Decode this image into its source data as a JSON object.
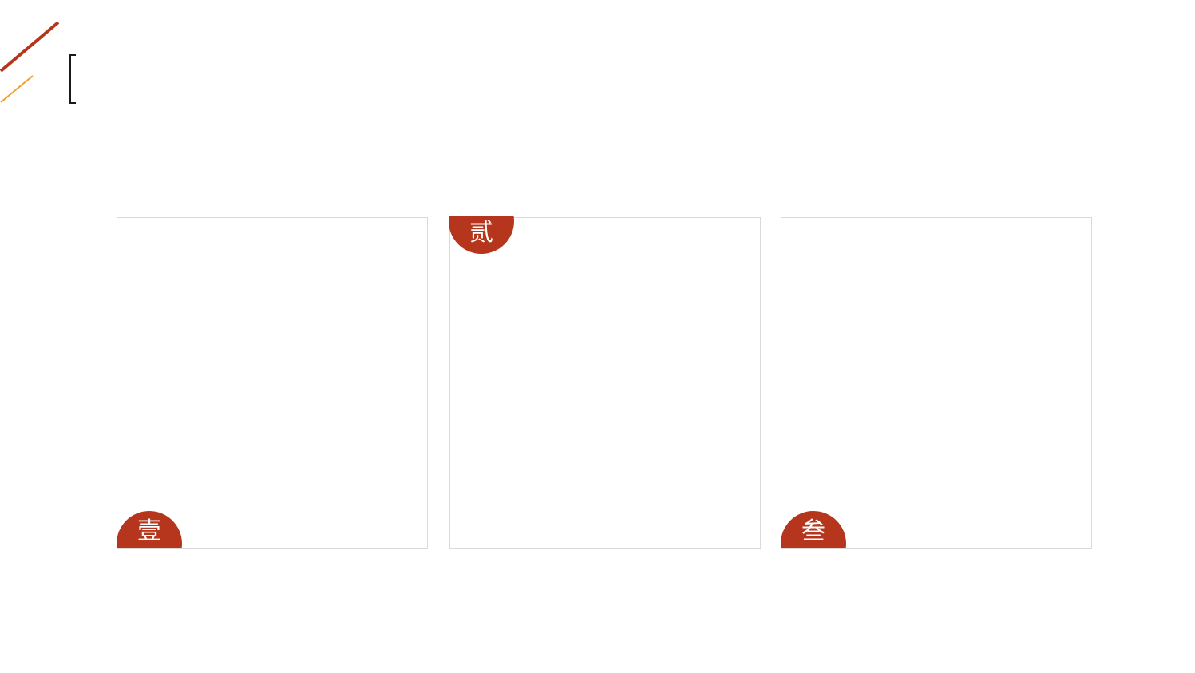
{
  "slide": {
    "title": "",
    "accent_color": "#b5361c",
    "secondary_accent_color": "#f0a030"
  },
  "cards": [
    {
      "badge_label": "壹"
    },
    {
      "badge_label": "贰"
    },
    {
      "badge_label": "叁"
    }
  ]
}
